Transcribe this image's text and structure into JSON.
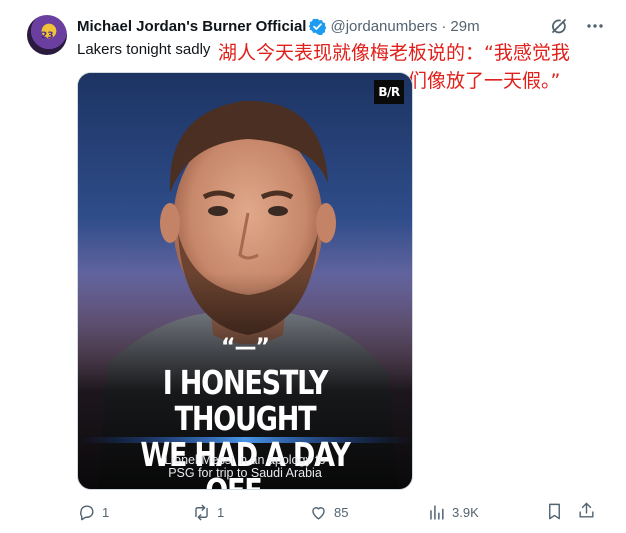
{
  "tweet": {
    "display_name": "Michael Jordan's Burner Official",
    "handle": "@jordanumbers",
    "separator": "·",
    "time": "29m",
    "text": "Lakers tonight sadly",
    "avatar_label": "23"
  },
  "overlay": {
    "line1": "湖人今天表现就像梅老板说的：“我感觉我",
    "line2": "们像放了一天假。”",
    "color": "#e0201b"
  },
  "media": {
    "logo": "B/R",
    "quote_marks": "“—”",
    "headline_line1": "I HONESTLY THOUGHT",
    "headline_line2": "WE HAD A DAY OFF...",
    "caption_line1": "Lionel Messi in an apology to",
    "caption_line2": "PSG for trip to Saudi Arabia"
  },
  "actions": {
    "replies": "1",
    "reposts": "1",
    "likes": "85",
    "views": "3.9K"
  },
  "colors": {
    "verified": "#1d9bf0",
    "secondary_text": "#536471",
    "primary_text": "#0f1419"
  },
  "icons": [
    "verified-badge-icon",
    "grok-icon",
    "more-icon",
    "reply-icon",
    "repost-icon",
    "like-icon",
    "views-icon",
    "bookmark-icon",
    "share-icon"
  ]
}
